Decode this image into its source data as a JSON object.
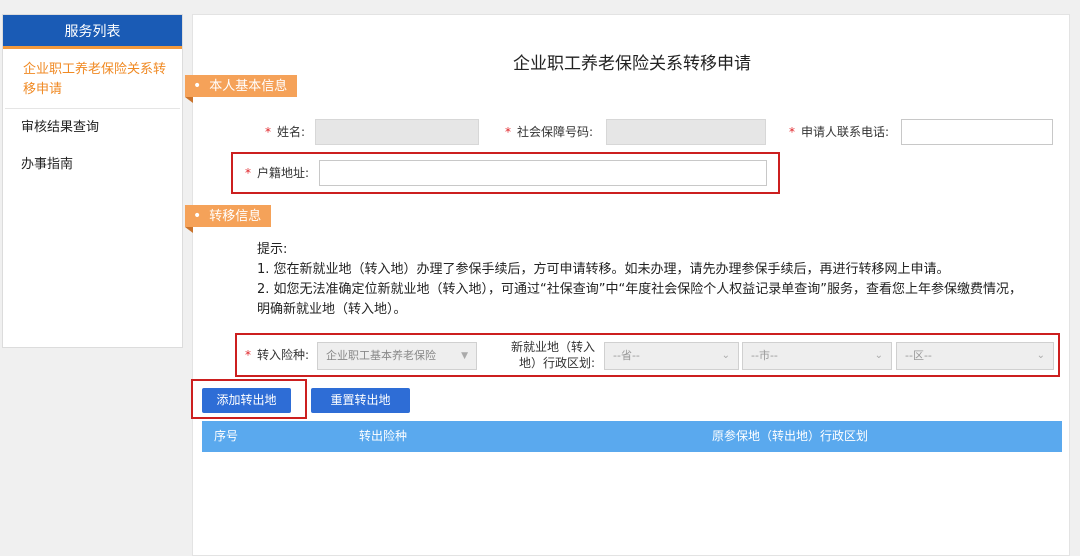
{
  "sidebar": {
    "title": "服务列表",
    "items": [
      {
        "label": "企业职工养老保险关系转移申请"
      },
      {
        "label": "审核结果查询"
      },
      {
        "label": "办事指南"
      }
    ]
  },
  "page": {
    "title": "企业职工养老保险关系转移申请"
  },
  "personal": {
    "section_title": "本人基本信息",
    "name_label": "姓名:",
    "ssn_label": "社会保障号码:",
    "phone_label": "申请人联系电话:",
    "household_label": "户籍地址:"
  },
  "transfer": {
    "section_title": "转移信息",
    "tips_title": "提示:",
    "tip1": "1. 您在新就业地（转入地）办理了参保手续后，方可申请转移。如未办理，请先办理参保手续后，再进行转移网上申请。",
    "tip2a": "2. 如您无法准确定位新就业地（转入地），可通过“社保查询”中“年度社会保险个人权益记录单查询”服务，查看您上年参保缴费情况，",
    "tip2b": "明确新就业地（转入地）。",
    "insurance_type_label": "转入险种:",
    "insurance_type_value": "企业职工基本养老保险",
    "region_label_line1": "新就业地（转入",
    "region_label_line2": "地）行政区划:",
    "province_placeholder": "--省--",
    "city_placeholder": "--市--",
    "district_placeholder": "--区--"
  },
  "buttons": {
    "add": "添加转出地",
    "reset": "重置转出地"
  },
  "table": {
    "columns": [
      "序号",
      "转出险种",
      "原参保地（转出地）行政区划"
    ]
  },
  "colors": {
    "brand_blue": "#1a5bb5",
    "accent_orange": "#f5a259",
    "table_header": "#5aa9ee",
    "highlight_red": "#cc1f1f"
  }
}
